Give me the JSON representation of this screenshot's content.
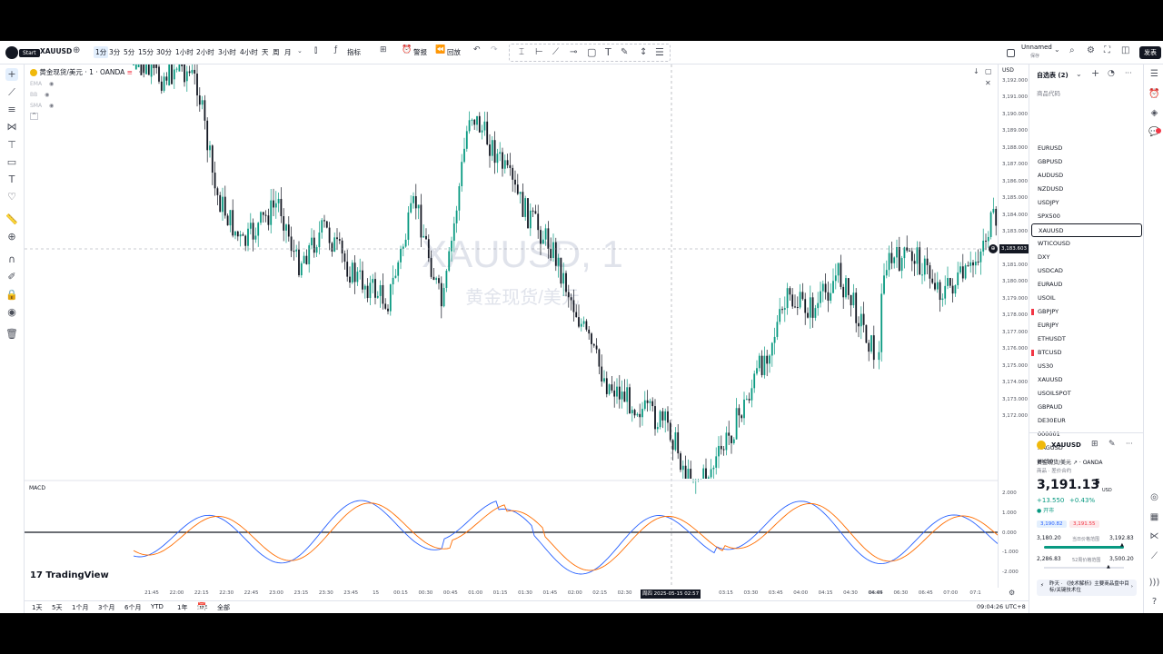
{
  "toolbar": {
    "start_label": "Start",
    "symbol": "XAUUSD",
    "intervals": [
      "1分",
      "3分",
      "5分",
      "15分",
      "30分",
      "1小时",
      "2小时",
      "3小时",
      "4小时",
      "天",
      "周",
      "月"
    ],
    "indicators_label": "指标",
    "alert_label": "警报",
    "replay_label": "回放",
    "layout_name": "Unnamed",
    "layout_sub": "保存",
    "publish_label": "发表"
  },
  "legend": {
    "title": "黄金现货/美元 · 1 · OANDA",
    "indicators": [
      "EMA",
      "BB",
      "SMA"
    ]
  },
  "watermark": {
    "symbol": "XAUUSD, 1",
    "name": "黄金现货/美元"
  },
  "price_axis": {
    "currency": "USD",
    "labels": [
      "3,192.000",
      "3,191.000",
      "3,190.000",
      "3,189.000",
      "3,188.000",
      "3,187.000",
      "3,186.000",
      "3,185.000",
      "3,184.000",
      "3,183.000",
      "3,182.000",
      "3,181.000",
      "3,180.000",
      "3,179.000",
      "3,178.000",
      "3,177.000",
      "3,176.000",
      "3,175.000",
      "3,174.000",
      "3,173.000",
      "3,172.000"
    ],
    "current_price": "3,183.603",
    "macd_labels": [
      "2.000",
      "1.000",
      "0.000",
      "-1.000",
      "-2.000"
    ]
  },
  "macd_label": "MACD",
  "branding": "TradingView",
  "time_axis": {
    "labels": [
      "21:45",
      "22:00",
      "22:15",
      "22:30",
      "22:45",
      "23:00",
      "23:15",
      "23:30",
      "23:45",
      "15",
      "00:15",
      "00:30",
      "00:45",
      "01:00",
      "01:15",
      "01:30",
      "01:45",
      "02:00",
      "02:15",
      "02:30",
      "03:15",
      "03:30",
      "03:45",
      "04:00",
      "04:15",
      "04:30",
      "04:45",
      "06:04",
      "06:30",
      "06:45",
      "07:00",
      "07:1"
    ],
    "crosshair_time": "周四 2025-05-15  02:57"
  },
  "bottom_bar": {
    "ranges": [
      "1天",
      "5天",
      "1个月",
      "3个月",
      "6个月",
      "YTD",
      "1年",
      "5年",
      "全部"
    ],
    "clock": "09:04:26 UTC+8"
  },
  "watchlist": {
    "title": "自选表 (2)",
    "column_header": "商品代码",
    "symbols": [
      "EURUSD",
      "GBPUSD",
      "AUDUSD",
      "NZDUSD",
      "USDJPY",
      "SPX500",
      "XAUUSD",
      "WTICOUSD",
      "DXY",
      "USDCAD",
      "EURAUD",
      "USOIL",
      "GBPJPY",
      "EURJPY",
      "ETHUSDT",
      "BTCUSD",
      "US30",
      "XAUUSD",
      "USOILSPOT",
      "GBPAUD",
      "DE30EUR",
      "000001",
      "XAGUSD",
      "HK50"
    ],
    "selected_index": 6,
    "flagged": [
      12,
      15
    ]
  },
  "details": {
    "symbol": "XAUUSD",
    "name": "黄金现货/美元",
    "exchange": "OANDA",
    "type": "商品 · 差价合约",
    "price_main": "3,191.13",
    "price_small": "5",
    "currency": "USD",
    "change": "+13.550",
    "change_pct": "+0.43%",
    "market_status": "开市",
    "bid": "3,190.82",
    "ask": "3,191.55",
    "day_low": "3,180.20",
    "day_high": "3,192.83",
    "day_range_label": "当日价格范围",
    "wk52_low": "2,286.83",
    "wk52_high": "3,500.20",
    "wk52_label": "52周价格范围",
    "news_when": "昨天",
    "news_text": "《技术解析》主要商品盘中目标/关键技术位"
  },
  "colors": {
    "up": "#089981",
    "down": "#131722",
    "macd": "#2962ff",
    "signal": "#ff6d00",
    "accent": "#2962ff"
  }
}
